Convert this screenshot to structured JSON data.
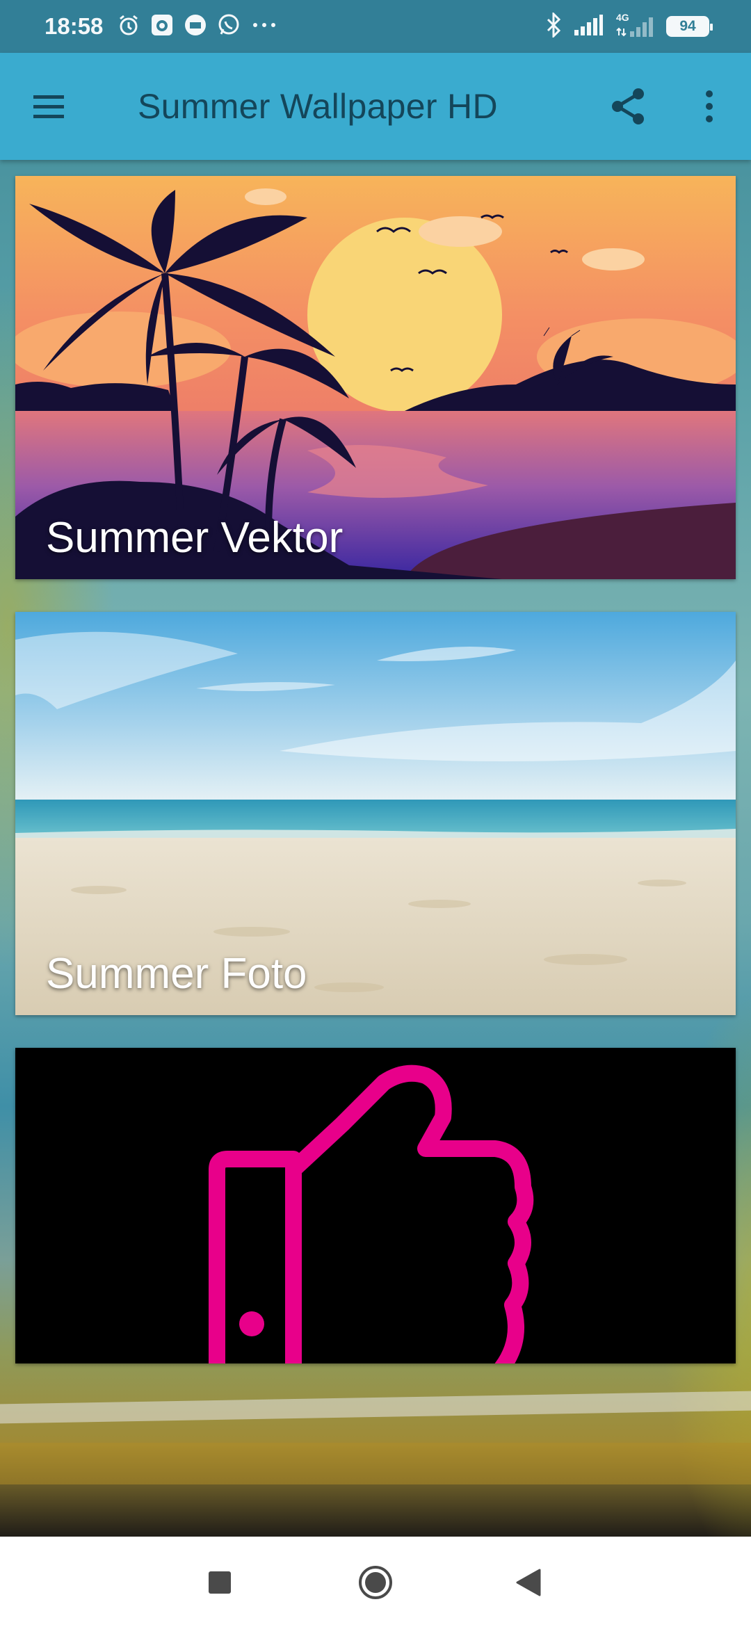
{
  "status_bar": {
    "time": "18:58",
    "network_label": "4G",
    "battery": "94"
  },
  "app_bar": {
    "title": "Summer Wallpaper HD",
    "menu_icon": "hamburger-menu-icon",
    "share_icon": "share-icon",
    "more_icon": "more-vertical-icon"
  },
  "cards": [
    {
      "label": "Summer Vektor"
    },
    {
      "label": "Summer Foto"
    },
    {
      "label": ""
    }
  ],
  "nav_bar": {
    "recents_icon": "square-recents-icon",
    "home_icon": "circle-home-icon",
    "back_icon": "triangle-back-icon"
  },
  "colors": {
    "status_bar": "#327f97",
    "app_bar": "#3aabcf",
    "title_text": "#14465a",
    "thumb_pink": "#e8008a"
  }
}
